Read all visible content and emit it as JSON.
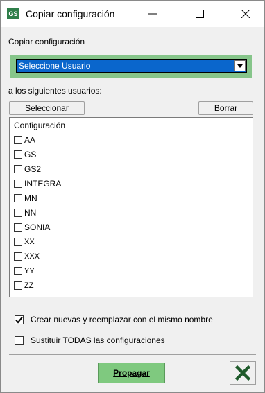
{
  "window": {
    "app_icon_text": "GS",
    "title": "Copiar configuración"
  },
  "form": {
    "source_label": "Copiar configuración",
    "source_select_value": "Seleccione Usuario",
    "targets_label": "a los siguientes usuarios:",
    "select_button": "Seleccionar",
    "clear_button": "Borrar",
    "list_header": "Configuración",
    "users": [
      {
        "name": "AA",
        "checked": false
      },
      {
        "name": "GS",
        "checked": false
      },
      {
        "name": "GS2",
        "checked": false
      },
      {
        "name": "INTEGRA",
        "checked": false
      },
      {
        "name": "MN",
        "checked": false
      },
      {
        "name": "NN",
        "checked": false
      },
      {
        "name": "SONIA",
        "checked": false
      },
      {
        "name": "XX",
        "checked": false
      },
      {
        "name": "XXX",
        "checked": false
      },
      {
        "name": "YY",
        "checked": false
      },
      {
        "name": "ZZ",
        "checked": false
      }
    ],
    "option_create_replace": {
      "label": "Crear nuevas y reemplazar con el mismo nombre",
      "checked": true
    },
    "option_replace_all": {
      "label": "Sustituir TODAS las configuraciones",
      "checked": false
    }
  },
  "footer": {
    "propagate_button": "Propagar"
  },
  "colors": {
    "select_bg": "#0a66cc",
    "green_frame": "#86c58a",
    "propagate_bg": "#7fc97f",
    "app_icon_bg": "#2f7f4a"
  }
}
